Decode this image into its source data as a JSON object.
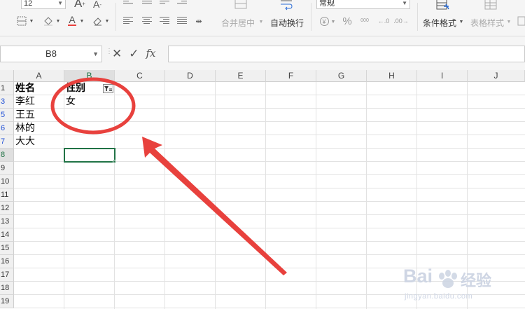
{
  "ribbon": {
    "font_size": "12",
    "number_format": "常规",
    "merge_label": "合并居中",
    "wrap_label": "自动换行",
    "conditional_label": "条件格式",
    "table_style_label": "表格样式",
    "percent": "%",
    "thousands": "000"
  },
  "formula_bar": {
    "cell_ref": "B8",
    "formula_value": ""
  },
  "grid": {
    "columns": [
      "A",
      "B",
      "C",
      "D",
      "E",
      "F",
      "G",
      "H",
      "I",
      "J"
    ],
    "row_numbers": [
      "1",
      "3",
      "5",
      "6",
      "7",
      "8",
      "9",
      "10",
      "11",
      "12",
      "13",
      "14",
      "15",
      "16",
      "17",
      "18",
      "19"
    ],
    "header_row": {
      "a": "姓名",
      "b": "性别"
    },
    "data_rows": [
      {
        "a": "李红",
        "b": "女"
      },
      {
        "a": "王五",
        "b": ""
      },
      {
        "a": "林的",
        "b": ""
      },
      {
        "a": "大大",
        "b": ""
      }
    ],
    "active_cell": "B8"
  },
  "annotation": {
    "circle_color": "#e8413d",
    "arrow_color": "#e8413d"
  },
  "watermark": {
    "brand": "Bai",
    "brand_cn": "经验",
    "url": "jingyan.baidu.com"
  }
}
